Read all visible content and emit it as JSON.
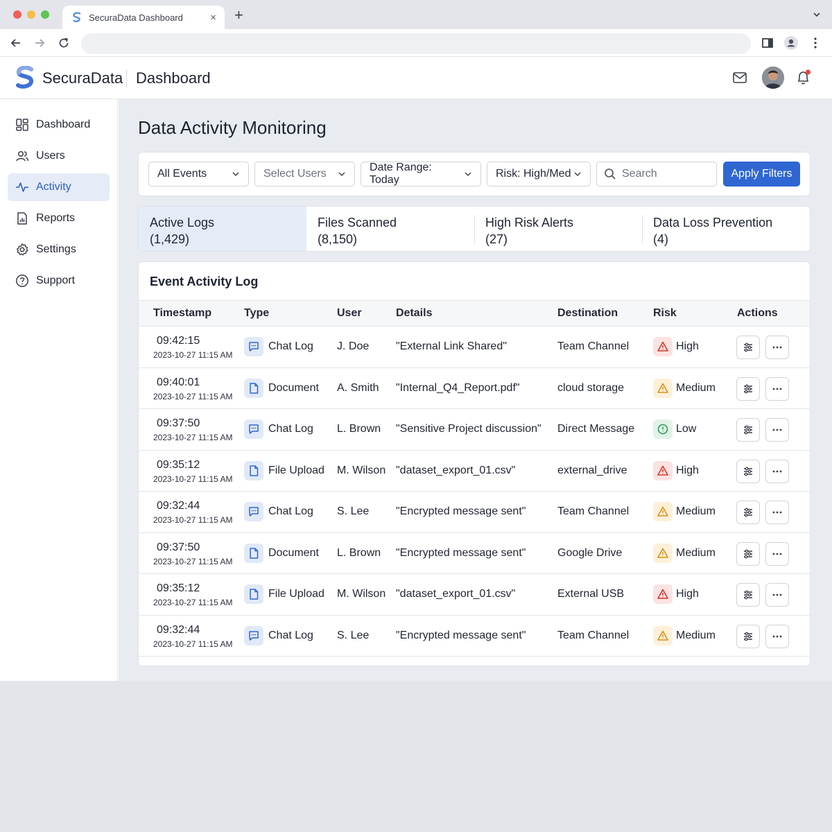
{
  "browser": {
    "tab_title": "SecuraData Dashboard",
    "tab_close": "×",
    "new_tab": "+"
  },
  "header": {
    "brand": "SecuraData",
    "title": "Dashboard"
  },
  "sidebar": {
    "items": [
      {
        "label": "Dashboard",
        "icon": "grid-icon"
      },
      {
        "label": "Users",
        "icon": "users-icon"
      },
      {
        "label": "Activity",
        "icon": "activity-icon",
        "active": true
      },
      {
        "label": "Reports",
        "icon": "reports-icon"
      },
      {
        "label": "Settings",
        "icon": "gear-icon"
      },
      {
        "label": "Support",
        "icon": "help-icon"
      }
    ]
  },
  "main": {
    "title": "Data Activity Monitoring",
    "filters": {
      "events": "All Events",
      "users": "Select Users",
      "date_range": "Date Range: Today",
      "risk": "Risk: High/Med",
      "search_placeholder": "Search",
      "apply": "Apply Filters"
    },
    "stats": [
      {
        "label": "Active Logs",
        "count": "(1,429)",
        "active": true
      },
      {
        "label": "Files Scanned",
        "count": "(8,150)"
      },
      {
        "label": "High Risk Alerts",
        "count": "(27)"
      },
      {
        "label": "Data Loss Prevention",
        "count": "(4)"
      }
    ],
    "log": {
      "title": "Event Activity Log",
      "columns": [
        "Timestamp",
        "Type",
        "User",
        "Details",
        "Destination",
        "Risk",
        "Actions"
      ],
      "rows": [
        {
          "time": "09:42:15",
          "date": "2023-10-27 11:15 AM",
          "type": "Chat Log",
          "user": "J. Doe",
          "details": "\"External Link Shared\"",
          "destination": "Team Channel",
          "risk": "High"
        },
        {
          "time": "09:40:01",
          "date": "2023-10-27 11:15 AM",
          "type": "Document",
          "user": "A. Smith",
          "details": "\"Internal_Q4_Report.pdf\"",
          "destination": "cloud storage",
          "risk": "Medium"
        },
        {
          "time": "09:37:50",
          "date": "2023-10-27 11:15 AM",
          "type": "Chat Log",
          "user": "L. Brown",
          "details": "\"Sensitive Project discussion\"",
          "destination": "Direct Message",
          "risk": "Low"
        },
        {
          "time": "09:35:12",
          "date": "2023-10-27 11:15 AM",
          "type": "File Upload",
          "user": "M. Wilson",
          "details": "\"dataset_export_01.csv\"",
          "destination": "external_drive",
          "risk": "High"
        },
        {
          "time": "09:32:44",
          "date": "2023-10-27 11:15 AM",
          "type": "Chat Log",
          "user": "S. Lee",
          "details": "\"Encrypted message sent\"",
          "destination": "Team Channel",
          "risk": "Medium"
        },
        {
          "time": "09:37:50",
          "date": "2023-10-27 11:15 AM",
          "type": "Document",
          "user": "L. Brown",
          "details": "\"Encrypted message sent\"",
          "destination": "Google Drive",
          "risk": "Medium"
        },
        {
          "time": "09:35:12",
          "date": "2023-10-27 11:15 AM",
          "type": "File Upload",
          "user": "M. Wilson",
          "details": "\"dataset_export_01.csv\"",
          "destination": "External USB",
          "risk": "High"
        },
        {
          "time": "09:32:44",
          "date": "2023-10-27 11:15 AM",
          "type": "Chat Log",
          "user": "S. Lee",
          "details": "\"Encrypted message sent\"",
          "destination": "Team Channel",
          "risk": "Medium"
        }
      ]
    }
  },
  "colors": {
    "accent": "#2f66d2",
    "high": "#d9362f",
    "high_bg": "#fbe3e2",
    "medium": "#d8901a",
    "medium_bg": "#fdf0d9",
    "low": "#2f9a57",
    "low_bg": "#e1f3e7"
  }
}
